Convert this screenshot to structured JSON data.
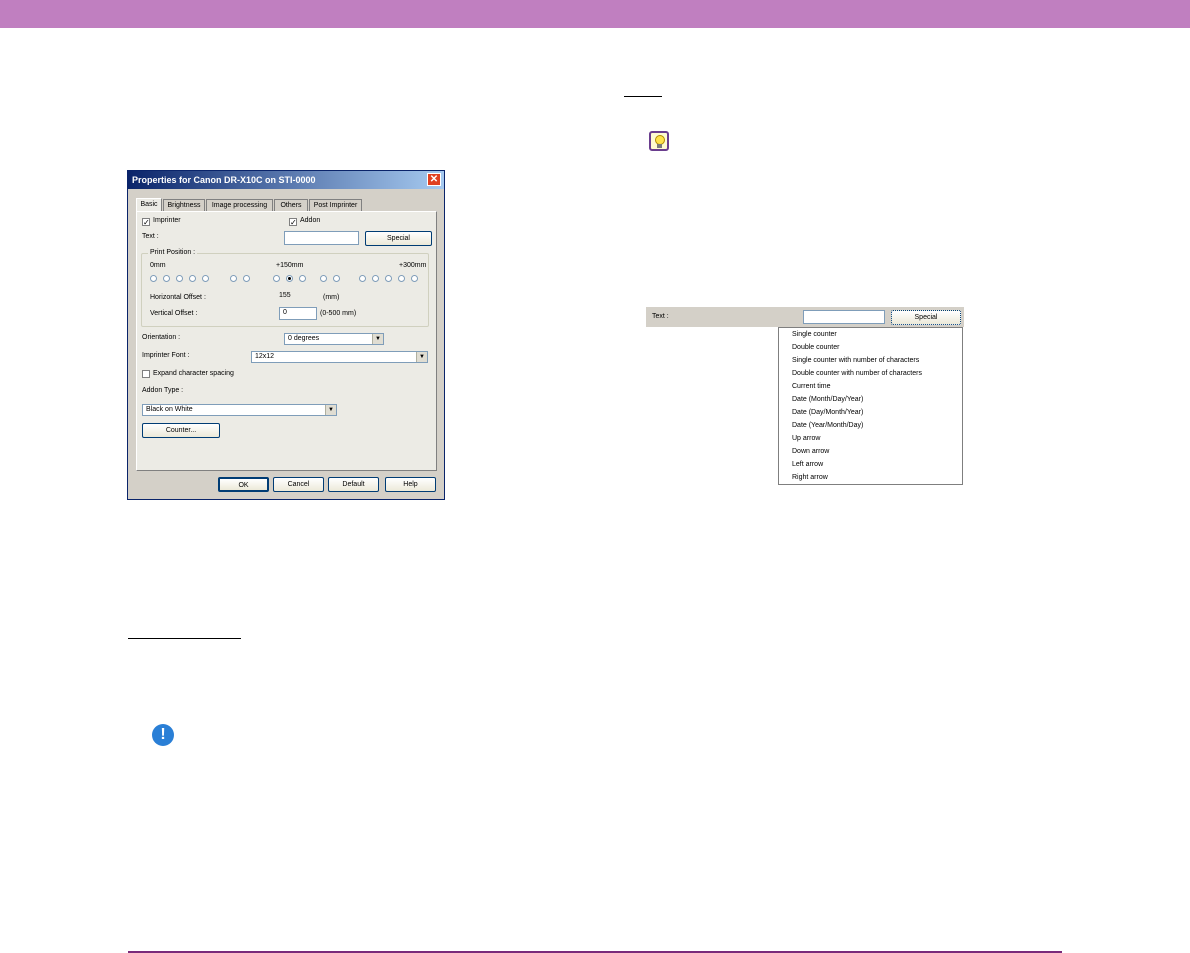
{
  "dialog": {
    "title": "Properties for Canon DR-X10C on STI-0000",
    "close_glyph": "✕",
    "tabs": [
      "Basic",
      "Brightness",
      "Image processing",
      "Others",
      "Post Imprinter"
    ],
    "imprinter_label": "Imprinter",
    "imprinter_checked": true,
    "addon_label": "Addon",
    "addon_checked": true,
    "text_label": "Text :",
    "text_value": "",
    "special_button": "Special",
    "print_position_label": "Print Position :",
    "pos_0": "0mm",
    "pos_150": "+150mm",
    "pos_300": "+300mm",
    "horizontal_offset_label": "Horizontal Offset :",
    "horizontal_offset_value": "155",
    "horizontal_offset_unit": "(mm)",
    "vertical_offset_label": "Vertical Offset :",
    "vertical_offset_value": "0",
    "vertical_offset_range": "(0-500 mm)",
    "orientation_label": "Orientation :",
    "orientation_value": "0 degrees",
    "font_label": "Imprinter Font :",
    "font_value": "12x12",
    "expand_spacing_label": "Expand character spacing",
    "expand_spacing_checked": false,
    "addon_type_label": "Addon Type :",
    "addon_type_value": "Black on White",
    "counter_button": "Counter...",
    "ok_button": "OK",
    "cancel_button": "Cancel",
    "default_button": "Default",
    "help_button": "Help",
    "selected_position_index": 7
  },
  "special_menu": {
    "text_label": "Text :",
    "text_value": "",
    "special_button": "Special",
    "items": [
      "Single counter",
      "Double counter",
      "Single counter with number of characters",
      "Double counter with number of characters",
      "Current time",
      "Date (Month/Day/Year)",
      "Date (Day/Month/Year)",
      "Date (Year/Month/Day)",
      "Up arrow",
      "Down arrow",
      "Left arrow",
      "Right arrow"
    ]
  },
  "icons": {
    "hint": "lightbulb-icon",
    "important": "exclamation-icon",
    "important_glyph": "!"
  },
  "colors": {
    "header_band": "#c07fc0",
    "footer_line": "#7a2a7a",
    "titlebar": "#0a246a"
  }
}
